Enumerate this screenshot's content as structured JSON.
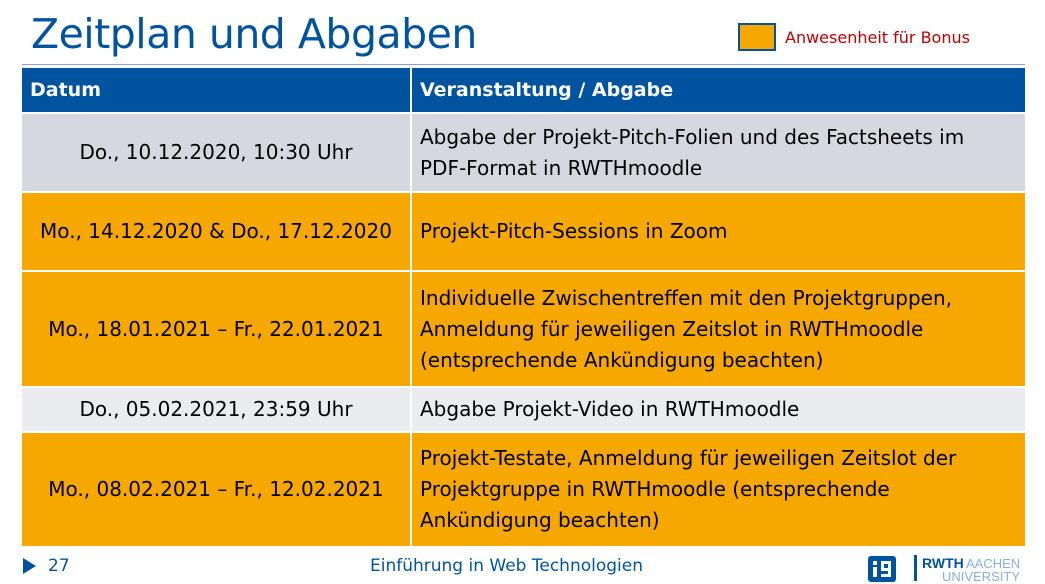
{
  "slide": {
    "title": "Zeitplan und Abgaben",
    "page_number": "27",
    "footer_title": "Einführung in Web Technologien"
  },
  "legend": {
    "label": "Anwesenheit für Bonus",
    "color": "#F6A800"
  },
  "colors": {
    "primary_blue": "#00549F",
    "orange": "#F6A800",
    "row_gray": "#D6D8E0",
    "row_light": "#EBECF0",
    "legend_text": "#c00000"
  },
  "table": {
    "headers": [
      "Datum",
      "Veranstaltung / Abgabe"
    ],
    "rows": [
      {
        "date": "Do., 10.12.2020, 10:30 Uhr",
        "lines": [
          "Abgabe der Projekt-Pitch-Folien und des Factsheets im",
          "PDF-Format in RWTHmoodle"
        ],
        "bonus": false
      },
      {
        "date": "Mo., 14.12.2020 & Do., 17.12.2020",
        "lines": [
          "Projekt-Pitch-Sessions in Zoom"
        ],
        "bonus": true
      },
      {
        "date": "Mo., 18.01.2021 – Fr., 22.01.2021",
        "lines": [
          "Individuelle Zwischentreffen mit den Projektgruppen,",
          "Anmeldung für jeweiligen Zeitslot in RWTHmoodle",
          "(entsprechende Ankündigung beachten)"
        ],
        "bonus": true
      },
      {
        "date": "Do., 05.02.2021, 23:59 Uhr",
        "lines": [
          "Abgabe Projekt-Video in RWTHmoodle"
        ],
        "bonus": false
      },
      {
        "date": "Mo., 08.02.2021 – Fr., 12.02.2021",
        "lines": [
          "Projekt-Testate, Anmeldung für jeweiligen Zeitslot der",
          "Projektgruppe in RWTHmoodle (entsprechende",
          "Ankündigung beachten)"
        ],
        "bonus": true
      }
    ]
  },
  "logos": {
    "university_bold": "RWTH",
    "university_light_1": "AACHEN",
    "university_light_2": "UNIVERSITY",
    "dept_icon": "i9-dept-logo-icon"
  }
}
